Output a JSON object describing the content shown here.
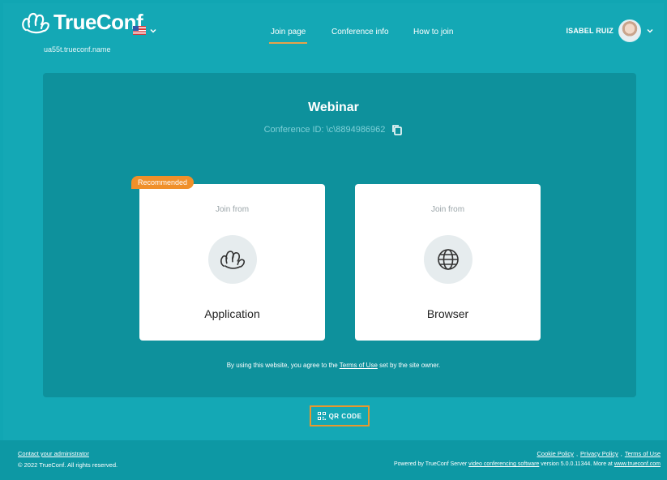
{
  "header": {
    "logo_text": "TrueConf",
    "server_name": "ua55t.trueconf.name",
    "nav": [
      {
        "label": "Join page"
      },
      {
        "label": "Conference info"
      },
      {
        "label": "How to join"
      }
    ],
    "user_name": "ISABEL RUIZ"
  },
  "conference": {
    "title": "Webinar",
    "id_text": "Conference ID: \\c\\8894986962"
  },
  "cards": {
    "badge": "Recommended",
    "application": {
      "subtitle": "Join from",
      "label": "Application"
    },
    "browser": {
      "subtitle": "Join from",
      "label": "Browser"
    }
  },
  "terms": {
    "before": "By using this website, you agree to the ",
    "link": "Terms of Use",
    "after": " set by the site owner."
  },
  "qr": {
    "label": "QR CODE"
  },
  "footer": {
    "contact": "Contact your administrator",
    "copyright": "© 2022 TrueConf. All rights reserved.",
    "links": [
      "Cookie Policy",
      "Privacy Policy",
      "Terms of Use"
    ],
    "powered_before": "Powered by TrueConf Server ",
    "powered_link": "video conferencing software",
    "powered_mid": " version 5.0.0.11344. More at ",
    "powered_site": "www.trueconf.com"
  },
  "colors": {
    "background": "#11a6b3",
    "panel": "#0e919c",
    "accent": "#f0902a",
    "card": "#ffffff"
  }
}
